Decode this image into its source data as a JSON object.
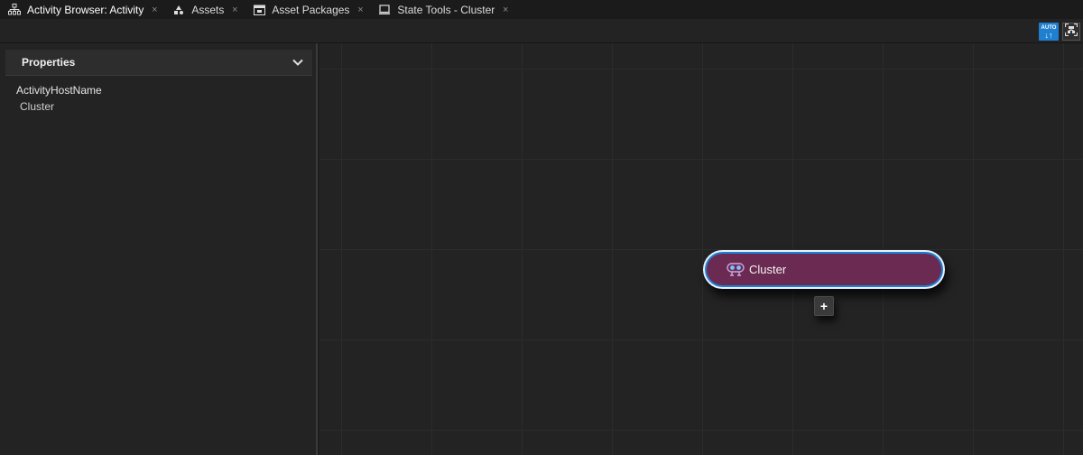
{
  "tabs": [
    {
      "label": "Activity Browser: Activity",
      "icon": "hierarchy-icon",
      "active": true
    },
    {
      "label": "Assets",
      "icon": "assets-icon",
      "active": false
    },
    {
      "label": "Asset Packages",
      "icon": "package-icon",
      "active": false
    },
    {
      "label": "State Tools - Cluster",
      "icon": "monitor-icon",
      "active": false
    }
  ],
  "tab_close_glyph": "×",
  "toolbar": {
    "auto_label": "AUTO",
    "auto_arrows": "↓↑",
    "auto_icon": "auto-layout-icon",
    "fit_icon": "fit-view-icon"
  },
  "properties": {
    "title": "Properties",
    "collapse_icon": "chevron-down-icon",
    "name": "ActivityHostName",
    "value": "Cluster"
  },
  "graph": {
    "node_label": "Cluster",
    "node_icon": "cluster-icon",
    "add_label": "+"
  },
  "colors": {
    "accent": "#1f7fd0",
    "node_fill": "#6b2a52",
    "background": "#232323"
  }
}
